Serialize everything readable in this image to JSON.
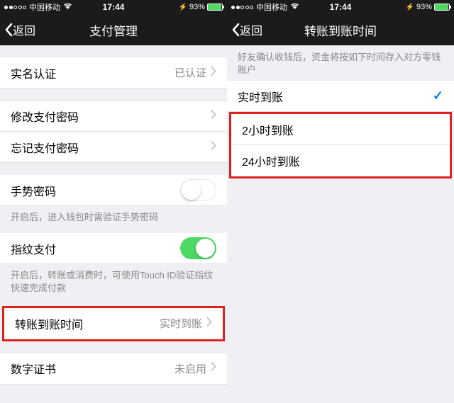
{
  "status": {
    "carrier": "中国移动",
    "time": "17:44",
    "battery_pct": "93%"
  },
  "left": {
    "back": "返回",
    "title": "支付管理",
    "realname_label": "实名认证",
    "realname_value": "已认证",
    "change_pwd": "修改支付密码",
    "forgot_pwd": "忘记支付密码",
    "gesture_label": "手势密码",
    "gesture_hint": "开启后，进入钱包时需验证手势密码",
    "touchid_label": "指纹支付",
    "touchid_hint": "开启后，转账或消费时，可使用Touch ID验证指纹快速完成付款",
    "transfer_time_label": "转账到账时间",
    "transfer_time_value": "实时到账",
    "cert_label": "数字证书",
    "cert_value": "未启用"
  },
  "right": {
    "back": "返回",
    "title": "转账到账时间",
    "hint": "好友确认收钱后，资金将按如下时间存入对方零钱账户",
    "opt_instant": "实时到账",
    "opt_2h": "2小时到账",
    "opt_24h": "24小时到账"
  }
}
